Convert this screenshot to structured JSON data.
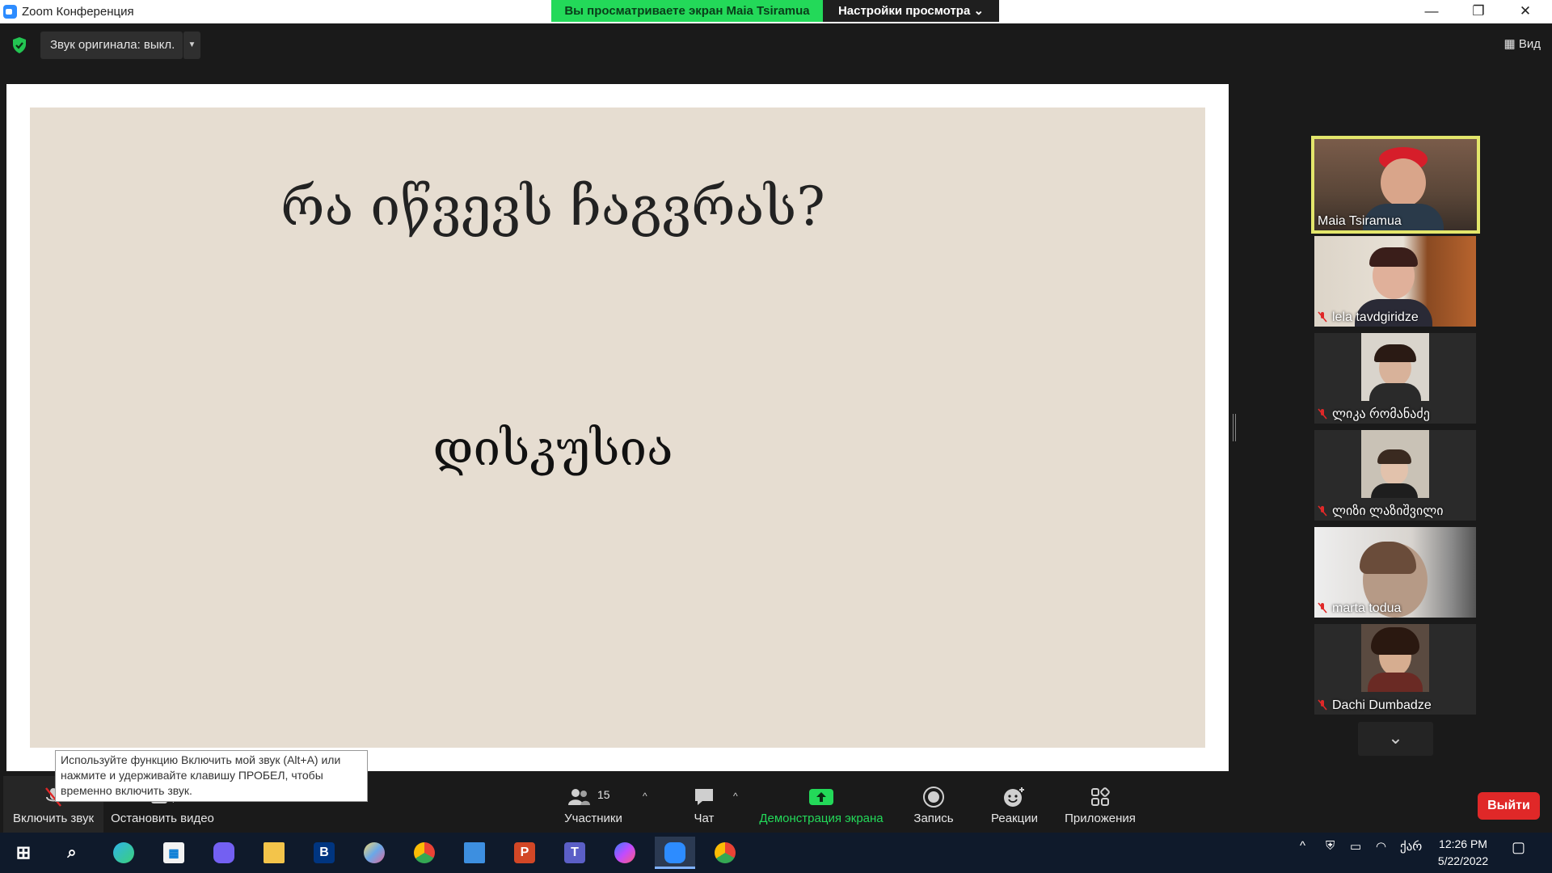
{
  "window": {
    "title": "Zoom Конференция",
    "share_banner": "Вы просматриваете экран Maia Tsiramua",
    "view_settings": "Настройки просмотра",
    "minimize": "—",
    "restore": "❐",
    "close": "✕"
  },
  "topbar": {
    "original_sound": "Звук оригинала: выкл.",
    "dropdown": "▼",
    "view": "Вид"
  },
  "slide": {
    "title": "რა იწვევს ჩაგვრას?",
    "subtitle": "დისკუსია"
  },
  "participants": [
    {
      "name": "Maia Tsiramua",
      "muted": false,
      "active": true
    },
    {
      "name": "lela tavdgiridze",
      "muted": true,
      "active": false
    },
    {
      "name": "ლიკა რომანაძე",
      "muted": true,
      "active": false
    },
    {
      "name": "ლიზი ლაზიშვილი",
      "muted": true,
      "active": false
    },
    {
      "name": "marta todua",
      "muted": true,
      "active": false
    },
    {
      "name": "Dachi Dumbadze",
      "muted": true,
      "active": false
    }
  ],
  "expand_chevron": "⌄",
  "tooltip": "Используйте функцию Включить мой звук (Alt+A) или нажмите и удерживайте клавишу ПРОБЕЛ, чтобы временно включить звук.",
  "toolbar": {
    "unmute": "Включить звук",
    "stop_video": "Остановить видео",
    "participants": "Участники",
    "participants_count": "15",
    "chat": "Чат",
    "share": "Демонстрация экрана",
    "record": "Запись",
    "reactions": "Реакции",
    "apps": "Приложения",
    "leave": "Выйти",
    "caret": "^"
  },
  "taskbar": {
    "apps": [
      {
        "icon": "windows-start-icon"
      },
      {
        "icon": "search-icon"
      },
      {
        "icon": "edge-icon"
      },
      {
        "icon": "store-icon"
      },
      {
        "icon": "viber-icon"
      },
      {
        "icon": "explorer-icon"
      },
      {
        "icon": "booking-icon",
        "letter": "B"
      },
      {
        "icon": "paint-icon"
      },
      {
        "icon": "chrome-icon"
      },
      {
        "icon": "mail-icon"
      },
      {
        "icon": "powerpoint-icon",
        "letter": "P"
      },
      {
        "icon": "teams-icon",
        "letter": "T"
      },
      {
        "icon": "messenger-icon"
      },
      {
        "icon": "zoom-icon"
      },
      {
        "icon": "chrome-icon"
      }
    ],
    "language": "ქარ",
    "time": "12:26 PM",
    "date": "5/22/2022"
  },
  "colors": {
    "share_banner": "#23d959",
    "active_speaker_border": "#e3e66b",
    "share_button": "#23d959",
    "leave_button": "#e02828"
  }
}
